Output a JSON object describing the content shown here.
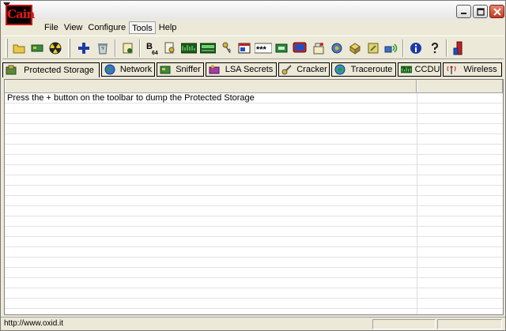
{
  "app": {
    "logo_text": "Cain"
  },
  "window_buttons": {
    "minimize": "minimize-icon",
    "maximize": "maximize-icon",
    "close": "close-icon"
  },
  "menu": [
    {
      "label": "File"
    },
    {
      "label": "View"
    },
    {
      "label": "Configure"
    },
    {
      "label": "Tools"
    },
    {
      "label": "Help"
    }
  ],
  "toolbar": {
    "icons": [
      "open-folder-icon",
      "network-card-icon",
      "radiation-icon",
      "plus-icon",
      "recycle-bin-icon",
      "certificate-icon",
      "base64-icon",
      "key-search-icon",
      "hash-calculator-icon",
      "rsa-calculator-icon",
      "key-icon",
      "password-window-icon",
      "asterisk-password-icon",
      "lock-box-icon",
      "monitor-icon",
      "route-icon",
      "keys-icon",
      "box-icon",
      "lock-icon",
      "wifi-icon",
      "info-icon",
      "help-icon",
      "exit-icon"
    ],
    "base64_label": "B",
    "base64_sub": "64",
    "asterisk_label": "***"
  },
  "tabs": [
    {
      "label": "Protected Storage",
      "icon": "protected-storage-icon"
    },
    {
      "label": "Network",
      "icon": "globe-icon"
    },
    {
      "label": "Sniffer",
      "icon": "sniffer-icon"
    },
    {
      "label": "LSA Secrets",
      "icon": "lsa-secrets-icon"
    },
    {
      "label": "Cracker",
      "icon": "cracker-icon"
    },
    {
      "label": "Traceroute",
      "icon": "traceroute-icon"
    },
    {
      "label": "CCDU",
      "icon": "ccdu-icon"
    },
    {
      "label": "Wireless",
      "icon": "wireless-icon"
    }
  ],
  "list": {
    "rows": [
      "Press the + button on the toolbar to dump the Protected Storage"
    ]
  },
  "status": {
    "text": "http://www.oxid.it"
  },
  "colors": {
    "accent_red": "#d01010",
    "face": "#ece9d8",
    "plus_blue": "#1a3aa8"
  }
}
